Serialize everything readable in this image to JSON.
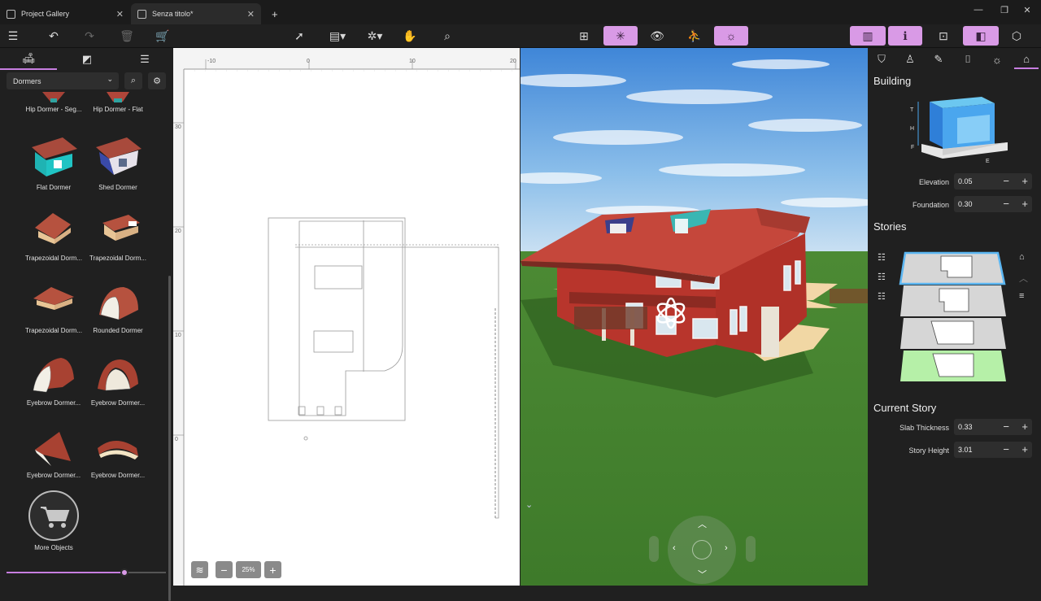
{
  "tabs": [
    {
      "label": "Project Gallery"
    },
    {
      "label": "Senza titolo*"
    }
  ],
  "left": {
    "category": "Dormers",
    "items": [
      {
        "label": "Hip Dormer - Seg..."
      },
      {
        "label": "Hip Dormer - Flat"
      },
      {
        "label": "Flat Dormer"
      },
      {
        "label": "Shed Dormer"
      },
      {
        "label": "Trapezoidal Dorm..."
      },
      {
        "label": "Trapezoidal Dorm..."
      },
      {
        "label": "Trapezoidal Dorm..."
      },
      {
        "label": "Rounded Dormer"
      },
      {
        "label": "Eyebrow Dormer..."
      },
      {
        "label": "Eyebrow Dormer..."
      },
      {
        "label": "Eyebrow Dormer..."
      },
      {
        "label": "Eyebrow Dormer..."
      }
    ],
    "more_label": "More Objects",
    "slider_value": 0.74
  },
  "plan": {
    "ruler_h": [
      "-10",
      "0",
      "10",
      "20"
    ],
    "ruler_v": [
      "30",
      "20",
      "10",
      "0"
    ],
    "zoom": "25%"
  },
  "right": {
    "building_title": "Building",
    "diagram_labels": {
      "t": "T",
      "h": "H",
      "f": "F",
      "e": "E"
    },
    "elevation": {
      "label": "Elevation",
      "value": "0.05"
    },
    "foundation": {
      "label": "Foundation",
      "value": "0.30"
    },
    "stories_title": "Stories",
    "current_story_title": "Current Story",
    "slab": {
      "label": "Slab Thickness",
      "value": "0.33"
    },
    "story_height": {
      "label": "Story Height",
      "value": "3.01"
    }
  },
  "colors": {
    "accent": "#d99ae6",
    "ground_story": "#b6f0a8"
  }
}
